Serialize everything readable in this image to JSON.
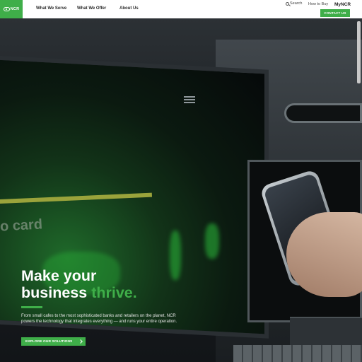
{
  "brand": {
    "logo_text": "NCR",
    "accent": "#3fae49"
  },
  "nav": {
    "items": [
      {
        "label": "What We Serve"
      },
      {
        "label": "What We Offer"
      },
      {
        "label": "About Us"
      }
    ]
  },
  "utility": {
    "search_label": "Search",
    "how_to_buy_label": "How to Buy",
    "myncr_label": "MyNCR",
    "contact_label": "CONTACT US"
  },
  "hero": {
    "screen_text": "o card",
    "headline_line1": "Make your",
    "headline_line2_a": "business ",
    "headline_line2_b": "thrive.",
    "description": "From small cafes to the most sophisticated banks and retailers on the planet, NCR powers the technology that integrates everything — and runs your entire operation.",
    "cta_label": "EXPLORE OUR SOLUTIONS"
  }
}
